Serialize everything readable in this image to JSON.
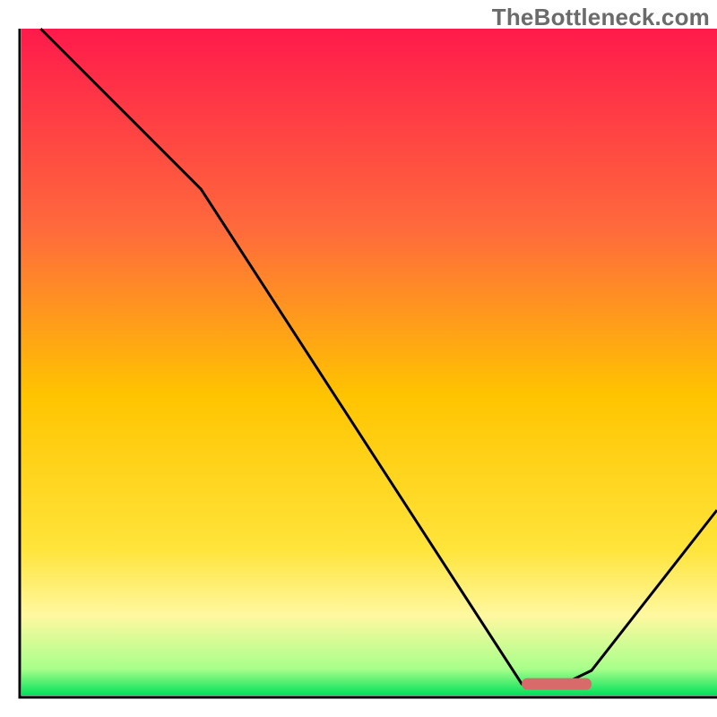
{
  "watermark": "TheBottleneck.com",
  "chart_data": {
    "type": "line",
    "title": "",
    "xlabel": "",
    "ylabel": "",
    "xlim": [
      0,
      100
    ],
    "ylim": [
      0,
      100
    ],
    "series": [
      {
        "name": "bottleneck-curve",
        "x": [
          3,
          26,
          72,
          78,
          82,
          100
        ],
        "values": [
          100,
          76,
          2,
          2,
          4,
          28
        ]
      }
    ],
    "marker": {
      "name": "optimal-range",
      "x_start": 72,
      "x_end": 82,
      "y": 2
    },
    "gradient_stops": [
      {
        "offset": 0,
        "color": "#ff1a4b"
      },
      {
        "offset": 30,
        "color": "#ff6a3c"
      },
      {
        "offset": 55,
        "color": "#ffc400"
      },
      {
        "offset": 78,
        "color": "#ffe43a"
      },
      {
        "offset": 88,
        "color": "#fff8a0"
      },
      {
        "offset": 96,
        "color": "#a8ff8a"
      },
      {
        "offset": 100,
        "color": "#00e05a"
      }
    ]
  }
}
